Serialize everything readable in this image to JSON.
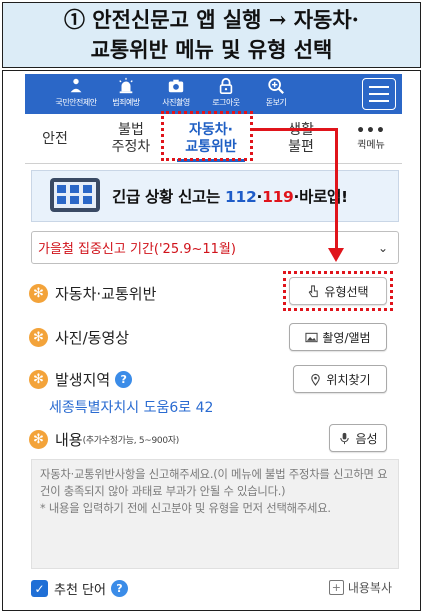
{
  "caption": {
    "line1": "① 안전신문고 앱 실행 → 자동차·",
    "line2": "교통위반 메뉴 및 유형 선택"
  },
  "topbar": {
    "items": [
      {
        "label": "국민안전제안",
        "icon": "megaphone-person-icon"
      },
      {
        "label": "범죄예방",
        "icon": "siren-icon"
      },
      {
        "label": "사진촬영",
        "icon": "camera-icon"
      },
      {
        "label": "로그아웃",
        "icon": "lock-icon"
      },
      {
        "label": "돋보기",
        "icon": "magnifier-plus-icon"
      }
    ],
    "menu_icon": "hamburger-icon"
  },
  "tabs": [
    {
      "label": "안전"
    },
    {
      "label": "불법\n주정차"
    },
    {
      "label": "자동차·\n교통위반"
    },
    {
      "label": "생활\n불편"
    },
    {
      "label": "퀵메뉴",
      "dots": "•••"
    }
  ],
  "banner": {
    "prefix": "긴급 상황 신고는 ",
    "num1": "112",
    "sep": "·",
    "num2": "119",
    "suffix": "·바로앱!"
  },
  "select": {
    "value": "가을철 집중신고 기간('25.9~11월)",
    "chevron": "⌄"
  },
  "rows": {
    "type_label": "자동차·교통위반",
    "type_button": "유형선택",
    "media_label": "사진/동영상",
    "media_button": "촬영/앨범",
    "location_label": "발생지역",
    "location_button": "위치찾기",
    "address": "세종특별자치시 도움6로 42",
    "content_label": "내용",
    "content_note": "(추가수정가능, 5~900자)",
    "voice_button": "음성"
  },
  "textarea": {
    "placeholder": "자동차·교통위반사항을 신고해주세요.(이 메뉴에 불법 주정차를 신고하면 요건이 충족되지 않아 과태료 부과가 안될 수 있습니다.)\n* 내용을 입력하기 전에 신고분야 및 유형을 먼저 선택해주세요."
  },
  "footer": {
    "checkbox_label": "추천 단어",
    "copy_label": "내용복사"
  },
  "colors": {
    "brand_blue": "#2b67c7",
    "highlight_red": "#e0141b",
    "star_orange": "#f3a33a",
    "caption_bg": "#dcecf7"
  }
}
